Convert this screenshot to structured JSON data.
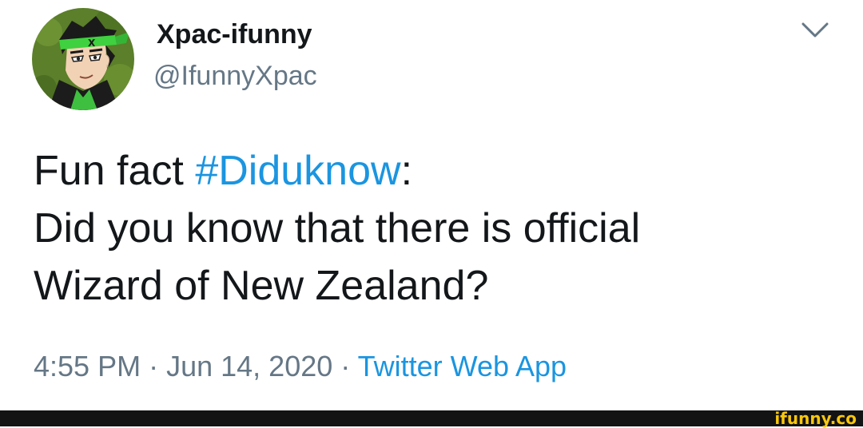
{
  "tweet": {
    "display_name": "Xpac-ifunny",
    "handle": "@IfunnyXpac",
    "text_line1_prefix": "Fun fact ",
    "hashtag": "#Diduknow",
    "text_line1_suffix": ":",
    "text_line2": "Did you know that there is official",
    "text_line3": "Wizard of New Zealand?",
    "time": "4:55 PM",
    "separator": " · ",
    "date": "Jun 14, 2020",
    "source": "Twitter Web App",
    "menu_icon": "chevron-down-icon"
  },
  "watermark": {
    "text": "ifunny.co"
  },
  "colors": {
    "name": "#14171a",
    "secondary": "#657786",
    "link": "#1b95e0",
    "watermark": "#f8c70d",
    "footer_bg": "#131313"
  }
}
